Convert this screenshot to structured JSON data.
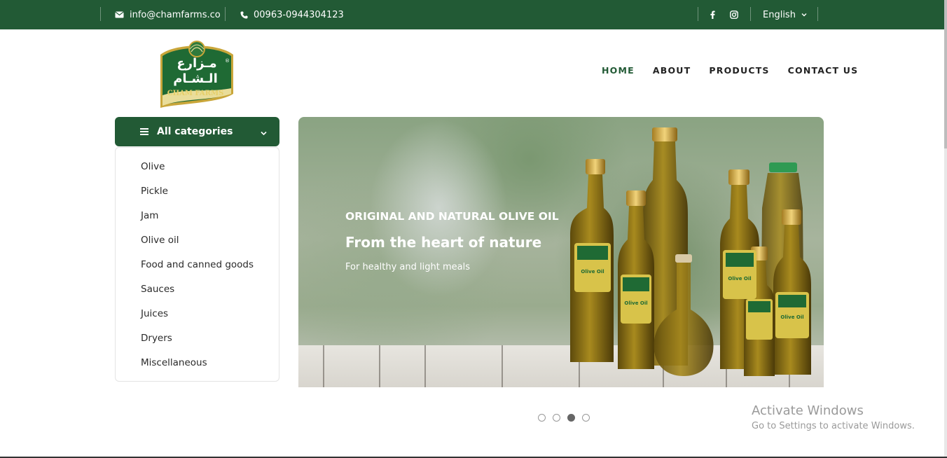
{
  "topbar": {
    "email": "info@chamfarms.co",
    "phone": "00963-0944304123",
    "language": "English"
  },
  "logo": {
    "arabic_line1": "مـزارع",
    "arabic_line2": "الـشـام",
    "english": "CHAM FARMS"
  },
  "nav": {
    "items": [
      "HOME",
      "ABOUT",
      "PRODUCTS",
      "CONTACT US"
    ],
    "active": "HOME"
  },
  "categories": {
    "title": "All categories",
    "items": [
      "Olive",
      "Pickle",
      "Jam",
      "Olive oil",
      "Food and canned goods",
      "Sauces",
      "Juices",
      "Dryers",
      "Miscellaneous"
    ]
  },
  "hero": {
    "heading": "ORIGINAL AND NATURAL OLIVE OIL",
    "subheading": "From the heart of nature",
    "tagline": "For healthy and light meals",
    "bottle_label": "Olive Oil"
  },
  "carousel": {
    "slides": 4,
    "active_index": 2
  },
  "watermark": {
    "line1": "Activate Windows",
    "line2": "Go to Settings to activate Windows."
  },
  "colors": {
    "brand_green": "#225a35",
    "gold": "#c9a63a"
  }
}
